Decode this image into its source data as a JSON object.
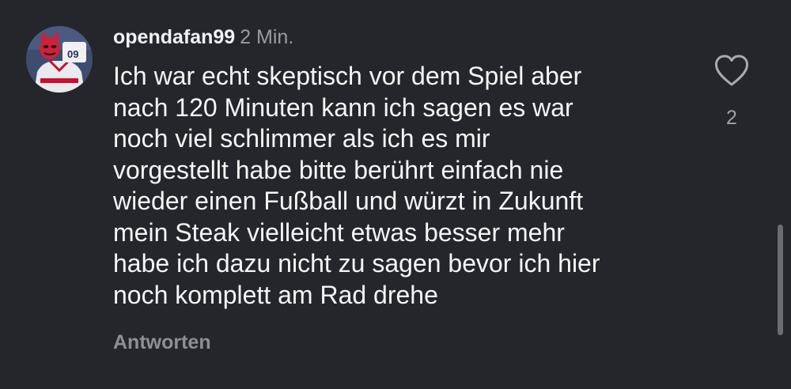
{
  "comment": {
    "username": "opendafan99",
    "timestamp": "2 Min.",
    "text": "Ich war echt skeptisch vor dem Spiel aber\nnach 120 Minuten kann ich sagen es war\nnoch viel schlimmer als ich es mir\nvorgestellt habe bitte berührt einfach nie\nwieder einen Fußball und würzt in Zukunft\nmein Steak vielleicht etwas besser mehr\nhabe ich dazu nicht zu sagen bevor ich hier\nnoch komplett am Rad drehe",
    "reply_label": "Antworten",
    "like_count": "2",
    "avatar_jersey_number": "09"
  },
  "icons": {
    "like": "heart-outline-icon"
  },
  "colors": {
    "background": "#25262b",
    "username": "#f2f2f2",
    "text": "#f5f5f5",
    "muted": "#9a9ba0"
  }
}
